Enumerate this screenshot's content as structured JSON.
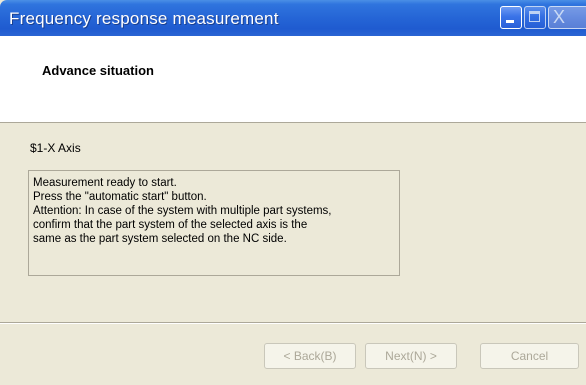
{
  "window": {
    "title": "Frequency response measurement",
    "controls": {
      "minimize": "minimize-icon",
      "maximize": "maximize-icon",
      "close": "close-icon",
      "close_glyph": "X"
    }
  },
  "header": {
    "title": "Advance situation"
  },
  "axis": {
    "label": "$1-X Axis"
  },
  "message": {
    "lines": [
      "Measurement ready to start.",
      "Press the \"automatic start\" button.",
      "Attention: In case of the system with multiple part systems,",
      "confirm that the part system of the selected axis is the",
      "same as the part system selected on the NC side."
    ]
  },
  "buttons": {
    "back": "< Back(B)",
    "next": "Next(N) >",
    "cancel": "Cancel"
  },
  "colors": {
    "titlebar": "#2565d6",
    "window_bg": "#ece9d8",
    "disabled_text": "#aca899"
  }
}
